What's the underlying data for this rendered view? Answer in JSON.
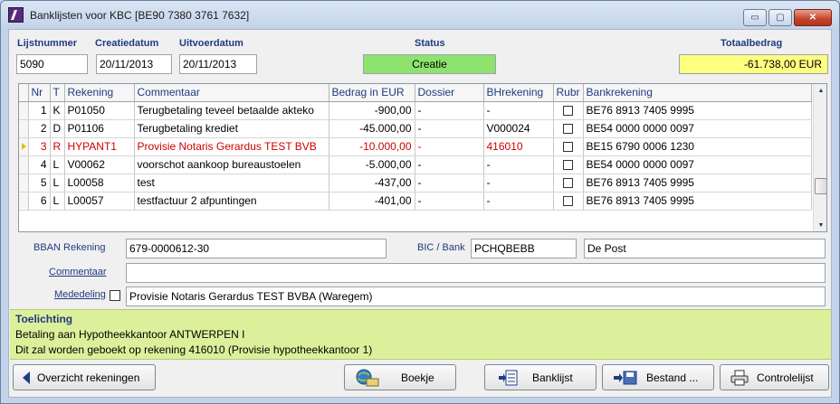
{
  "window": {
    "title": "Banklijsten voor KBC [BE90 7380 3761 7632]",
    "minimize_label": "▭",
    "maximize_label": "▢",
    "close_label": "✕"
  },
  "header": {
    "lijstnummer_label": "Lijstnummer",
    "lijstnummer_value": "5090",
    "creatiedatum_label": "Creatiedatum",
    "creatiedatum_value": "20/11/2013",
    "uitvoerdatum_label": "Uitvoerdatum",
    "uitvoerdatum_value": "20/11/2013",
    "status_label": "Status",
    "status_value": "Creatie",
    "totaal_label": "Totaalbedrag",
    "totaal_value": "-61.738,00  EUR"
  },
  "grid": {
    "columns": [
      "Nr",
      "T",
      "Rekening",
      "Commentaar",
      "Bedrag in EUR",
      "Dossier",
      "BHrekening",
      "Rubr",
      "Bankrekening"
    ],
    "rows": [
      {
        "nr": "1",
        "t": "K",
        "rekening": "P01050",
        "commentaar": "Terugbetaling teveel betaalde akteko",
        "bedrag": "-900,00",
        "dossier": "-",
        "bh": "-",
        "bank": "BE76 8913 7405 9995"
      },
      {
        "nr": "2",
        "t": "D",
        "rekening": "P01106",
        "commentaar": "Terugbetaling krediet",
        "bedrag": "-45.000,00",
        "dossier": "-",
        "bh": "V000024",
        "bank": "BE54 0000 0000 0097"
      },
      {
        "nr": "3",
        "t": "R",
        "rekening": "HYPANT1",
        "commentaar": "Provisie Notaris Gerardus TEST BVB",
        "bedrag": "-10.000,00",
        "dossier": "-",
        "bh": "416010",
        "bank": "BE15 6790 0006 1230"
      },
      {
        "nr": "4",
        "t": "L",
        "rekening": "V00062",
        "commentaar": "voorschot aankoop bureaustoelen",
        "bedrag": "-5.000,00",
        "dossier": "-",
        "bh": "-",
        "bank": "BE54 0000 0000 0097"
      },
      {
        "nr": "5",
        "t": "L",
        "rekening": "L00058",
        "commentaar": "test",
        "bedrag": "-437,00",
        "dossier": "-",
        "bh": "-",
        "bank": "BE76 8913 7405 9995"
      },
      {
        "nr": "6",
        "t": "L",
        "rekening": "L00057",
        "commentaar": "testfactuur 2 afpuntingen",
        "bedrag": "-401,00",
        "dossier": "-",
        "bh": "-",
        "bank": "BE76 8913 7405 9995"
      }
    ],
    "selected_row": 3
  },
  "details": {
    "bban_label": "BBAN Rekening",
    "bban_value": "679-0000612-30",
    "bic_label": "BIC / Bank",
    "bic_value": "PCHQBEBB",
    "bank_name": "De Post",
    "commentaar_label": "Commentaar",
    "commentaar_value": "",
    "mededeling_label": "Mededeling",
    "mededeling_value": "Provisie Notaris Gerardus TEST BVBA (Waregem)"
  },
  "toelichting": {
    "title": "Toelichting",
    "line1": "Betaling aan Hypotheekkantoor ANTWERPEN I",
    "line2": "Dit zal worden geboekt op rekening 416010 (Provisie hypotheekkantoor 1)"
  },
  "buttons": {
    "overzicht": "Overzicht rekeningen",
    "boekje": "Boekje",
    "banklijst": "Banklijst",
    "bestand": "Bestand ...",
    "controlelijst": "Controlelijst"
  },
  "colors": {
    "status_bg": "#8ee26e",
    "total_bg": "#ffff80",
    "toelichting_bg": "#dcf09b",
    "selected_text": "#d00000",
    "label_blue": "#1f3a80"
  }
}
